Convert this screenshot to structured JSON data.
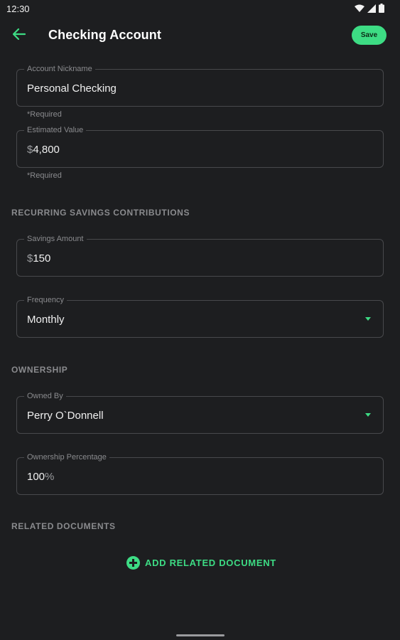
{
  "status_bar": {
    "time": "12:30",
    "icons": [
      "wifi-icon",
      "signal-icon",
      "battery-icon"
    ]
  },
  "app_bar": {
    "title": "Checking Account",
    "save_label": "Save",
    "back_icon": "arrow-back-icon"
  },
  "fields": {
    "nickname": {
      "label": "Account Nickname",
      "value": "Personal Checking",
      "helper": "*Required"
    },
    "estimated_value": {
      "label": "Estimated Value",
      "prefix": "$",
      "value": "4,800",
      "helper": "*Required"
    },
    "savings_amount": {
      "label": "Savings Amount",
      "prefix": "$",
      "value": "150"
    },
    "frequency": {
      "label": "Frequency",
      "value": "Monthly"
    },
    "owned_by": {
      "label": "Owned By",
      "value": "Perry O`Donnell"
    },
    "ownership_percentage": {
      "label": "Ownership Percentage",
      "value": "100",
      "suffix": "%"
    }
  },
  "sections": {
    "recurring": "RECURRING SAVINGS CONTRIBUTIONS",
    "ownership": "OWNERSHIP",
    "related_documents": "RELATED DOCUMENTS"
  },
  "add_document": {
    "label": "ADD RELATED DOCUMENT",
    "icon": "add-circle-icon"
  },
  "colors": {
    "background": "#1d1e20",
    "accent": "#3ddc84",
    "border": "#48494c",
    "muted_text": "#8a8b8e"
  }
}
